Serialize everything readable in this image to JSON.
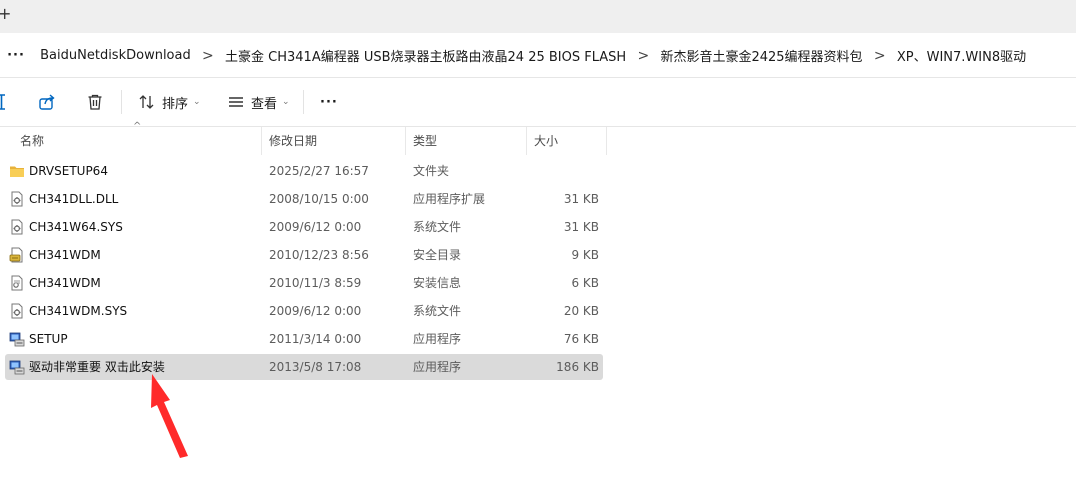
{
  "window": {
    "new_tab_glyph": "+"
  },
  "address_bar": {
    "more": "···",
    "crumbs": [
      "BaiduNetdiskDownload",
      "土豪金 CH341A编程器 USB烧录器主板路由液晶24 25 BIOS FLASH",
      "新杰影音土豪金2425编程器资料包",
      "XP、WIN7.WIN8驱动"
    ],
    "separator": ">"
  },
  "toolbar": {
    "sort_label": "排序",
    "view_label": "查看",
    "more_label": "···"
  },
  "columns": {
    "name": "名称",
    "date": "修改日期",
    "type": "类型",
    "size": "大小"
  },
  "files": [
    {
      "name": "DRVSETUP64",
      "date": "2025/2/27 16:57",
      "type": "文件夹",
      "size": "",
      "icon": "folder-icon"
    },
    {
      "name": "CH341DLL.DLL",
      "date": "2008/10/15 0:00",
      "type": "应用程序扩展",
      "size": "31 KB",
      "icon": "dll-file-icon"
    },
    {
      "name": "CH341W64.SYS",
      "date": "2009/6/12 0:00",
      "type": "系统文件",
      "size": "31 KB",
      "icon": "sys-file-icon"
    },
    {
      "name": "CH341WDM",
      "date": "2010/12/23 8:56",
      "type": "安全目录",
      "size": "9 KB",
      "icon": "catalog-file-icon"
    },
    {
      "name": "CH341WDM",
      "date": "2010/11/3 8:59",
      "type": "安装信息",
      "size": "6 KB",
      "icon": "inf-file-icon"
    },
    {
      "name": "CH341WDM.SYS",
      "date": "2009/6/12 0:00",
      "type": "系统文件",
      "size": "20 KB",
      "icon": "sys-file-icon"
    },
    {
      "name": "SETUP",
      "date": "2011/3/14 0:00",
      "type": "应用程序",
      "size": "76 KB",
      "icon": "setup-app-icon"
    },
    {
      "name": "驱动非常重要 双击此安装",
      "date": "2013/5/8 17:08",
      "type": "应用程序",
      "size": "186 KB",
      "icon": "setup-app-icon",
      "selected": true
    }
  ],
  "colors": {
    "accent": "#0067c0",
    "selection": "#dadada",
    "annotation_arrow": "#ff2a2a"
  }
}
